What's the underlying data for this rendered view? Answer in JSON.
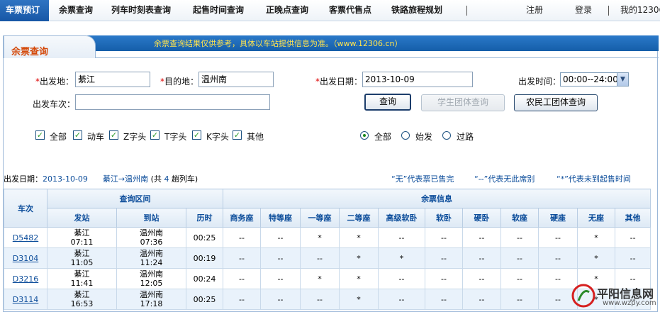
{
  "nav": {
    "items": [
      "车票预订",
      "余票查询",
      "列车时刻表查询",
      "起售时间查询",
      "正晚点查询",
      "客票代售点",
      "铁路旅程规划"
    ],
    "register": "注册",
    "login": "登录",
    "my12306": "我的12306"
  },
  "panel": {
    "title": "余票查询",
    "notice": "余票查询结果仅供参考，具体以车站提供信息为准。（www.12306.cn）"
  },
  "form": {
    "from_label": "出发地：",
    "from_value": "綦江",
    "to_label": "目的地：",
    "to_value": "温州南",
    "date_label": "出发日期：",
    "date_value": "2013-10-09",
    "time_label": "出发时间：",
    "time_value": "00:00--24:00",
    "train_no_label": "出发车次：",
    "train_no_value": "",
    "required_mark": "*",
    "query_button": "查询",
    "student_button": "学生团体查询",
    "migrant_button": "农民工团体查询"
  },
  "filters": {
    "types": [
      {
        "label": "全部",
        "checked": true
      },
      {
        "label": "动车",
        "checked": true
      },
      {
        "label": "Z字头",
        "checked": true
      },
      {
        "label": "T字头",
        "checked": true
      },
      {
        "label": "K字头",
        "checked": true
      },
      {
        "label": "其他",
        "checked": true
      }
    ],
    "stations": [
      {
        "label": "全部",
        "selected": true
      },
      {
        "label": "始发",
        "selected": false
      },
      {
        "label": "过路",
        "selected": false
      }
    ]
  },
  "summary": {
    "date_label": "出发日期：",
    "date": "2013-10-09",
    "route": "綦江→温州南",
    "count_prefix": "(共",
    "count": "4",
    "count_suffix": "趟列车)",
    "legend_none": "“无”代表票已售完",
    "legend_dash": "“--”代表无此席别",
    "legend_star": "“*”代表未到起售时间"
  },
  "table": {
    "h_train": "车次",
    "h_section": "查询区间",
    "h_remaining": "余票信息",
    "h_from": "发站",
    "h_to": "到站",
    "h_duration": "历时",
    "seat_headers": [
      "商务座",
      "特等座",
      "一等座",
      "二等座",
      "高级软卧",
      "软卧",
      "硬卧",
      "软座",
      "硬座",
      "无座",
      "其他"
    ],
    "rows": [
      {
        "train": "D5482",
        "from": "綦江",
        "dep": "07:11",
        "to": "温州南",
        "arr": "07:36",
        "duration": "00:25",
        "seats": [
          "--",
          "--",
          "*",
          "*",
          "--",
          "--",
          "--",
          "--",
          "--",
          "*",
          "--"
        ]
      },
      {
        "train": "D3104",
        "from": "綦江",
        "dep": "11:05",
        "to": "温州南",
        "arr": "11:24",
        "duration": "00:19",
        "seats": [
          "--",
          "--",
          "--",
          "*",
          "*",
          "--",
          "--",
          "--",
          "--",
          "*",
          "--"
        ]
      },
      {
        "train": "D3216",
        "from": "綦江",
        "dep": "11:41",
        "to": "温州南",
        "arr": "12:05",
        "duration": "00:24",
        "seats": [
          "--",
          "--",
          "*",
          "*",
          "--",
          "--",
          "--",
          "--",
          "--",
          "*",
          "--"
        ]
      },
      {
        "train": "D3114",
        "from": "綦江",
        "dep": "16:53",
        "to": "温州南",
        "arr": "17:18",
        "duration": "00:25",
        "seats": [
          "--",
          "--",
          "--",
          "*",
          "--",
          "--",
          "--",
          "--",
          "--",
          "*",
          "--"
        ]
      }
    ]
  },
  "watermark": {
    "name": "平阳信息网",
    "url": "www.wzpy.com"
  },
  "colors": {
    "accent": "#1a5fae",
    "title_orange": "#d4490a",
    "notice_yellow": "#ffe34d",
    "link_blue": "#0b4c9a"
  }
}
